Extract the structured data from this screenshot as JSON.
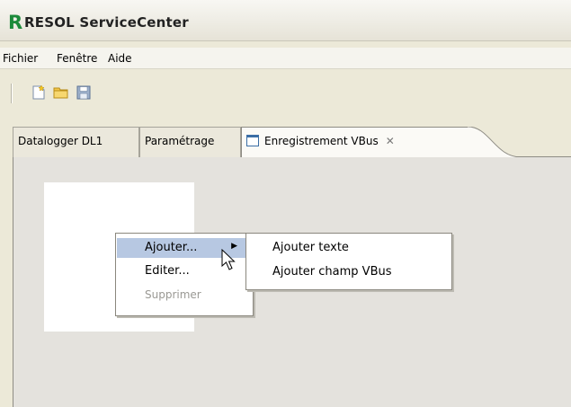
{
  "window": {
    "logo_letter": "R",
    "title": "RESOL ServiceCenter"
  },
  "menubar": {
    "items": [
      "Fichier",
      "Fenêtre",
      "Aide"
    ]
  },
  "toolbar": {
    "icons": [
      "new-document-icon",
      "open-folder-icon",
      "save-disk-icon"
    ]
  },
  "tabs": [
    {
      "label": "Datalogger DL1",
      "active": false
    },
    {
      "label": "Paramétrage",
      "active": false
    },
    {
      "label": "Enregistrement VBus",
      "active": true,
      "close_glyph": "✕"
    }
  ],
  "context_menu": {
    "items": [
      {
        "label": "Ajouter...",
        "state": "hover",
        "has_submenu": true,
        "submenu_glyph": "▶"
      },
      {
        "label": "Editer...",
        "state": "enabled"
      },
      {
        "label": "Supprimer",
        "state": "disabled"
      }
    ]
  },
  "submenu": {
    "items": [
      {
        "label": "Ajouter texte"
      },
      {
        "label": "Ajouter champ VBus"
      }
    ]
  },
  "colors": {
    "logo": "#1c8a3a",
    "hover": "#b7c8e2",
    "editor_bg": "#e4e2dd"
  }
}
